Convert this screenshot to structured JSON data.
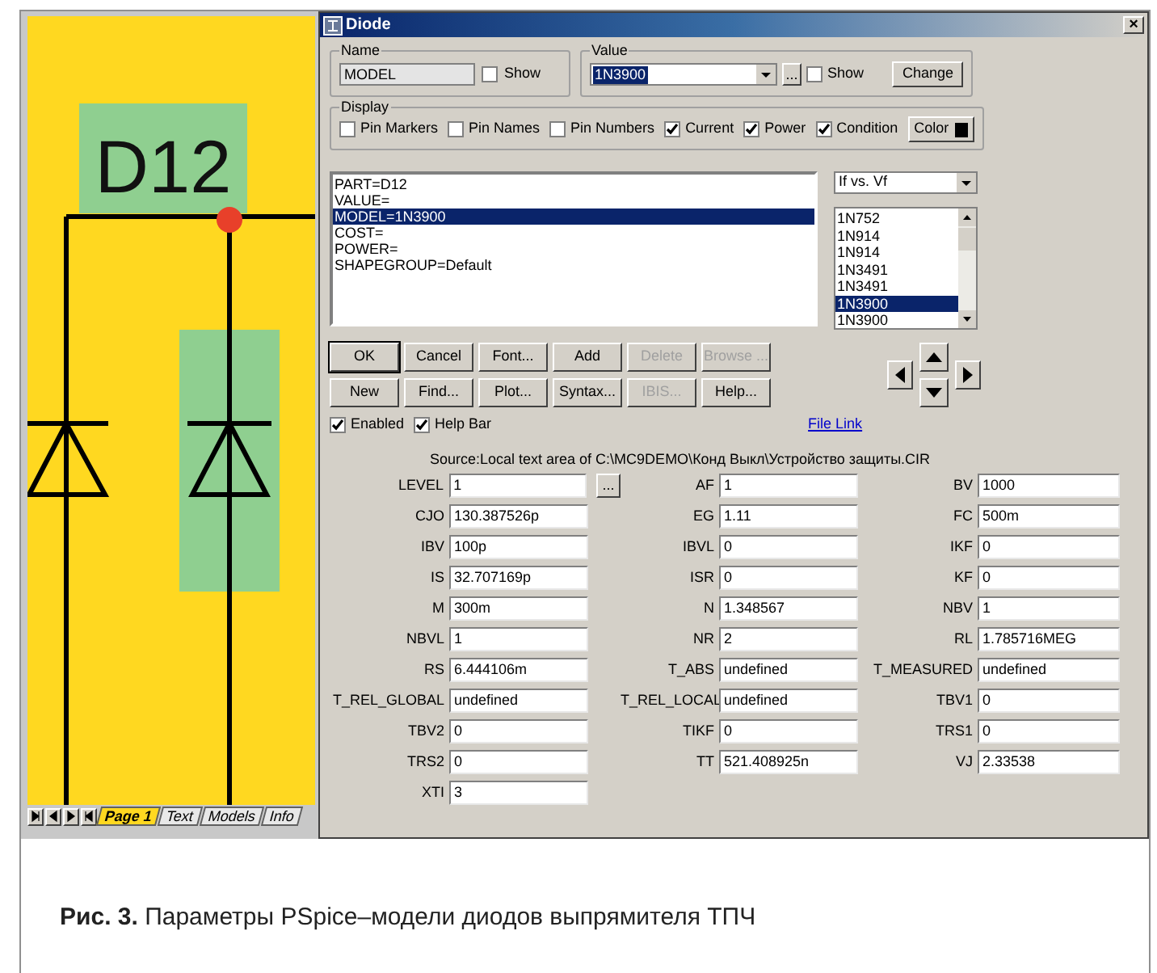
{
  "schematic": {
    "part_label": "D12",
    "tabs": [
      {
        "label": "Page 1",
        "selected": true
      },
      {
        "label": "Text",
        "selected": false
      },
      {
        "label": "Models",
        "selected": false
      },
      {
        "label": "Info",
        "selected": false
      }
    ]
  },
  "dialog": {
    "title": "Diode",
    "close": "×",
    "name_group": {
      "title": "Name",
      "value": "MODEL",
      "show": {
        "label": "Show",
        "checked": false
      }
    },
    "value_group": {
      "title": "Value",
      "value": "1N3900",
      "browse": "...",
      "show": {
        "label": "Show",
        "checked": false
      },
      "change": "Change"
    },
    "display": {
      "title": "Display",
      "color_button": "Color",
      "options": [
        {
          "label": "Pin Markers",
          "checked": false
        },
        {
          "label": "Pin Names",
          "checked": false
        },
        {
          "label": "Pin Numbers",
          "checked": false
        },
        {
          "label": "Current",
          "checked": true
        },
        {
          "label": "Power",
          "checked": true
        },
        {
          "label": "Condition",
          "checked": true
        }
      ]
    },
    "attributes": [
      {
        "text": "PART=D12",
        "selected": false
      },
      {
        "text": "VALUE=",
        "selected": false
      },
      {
        "text": "MODEL=1N3900",
        "selected": true
      },
      {
        "text": "COST=",
        "selected": false
      },
      {
        "text": "POWER=",
        "selected": false
      },
      {
        "text": "SHAPEGROUP=Default",
        "selected": false
      }
    ],
    "plot_select": "If vs. Vf",
    "models": [
      {
        "text": "1N752",
        "selected": false
      },
      {
        "text": "1N914",
        "selected": false
      },
      {
        "text": "1N914",
        "selected": false
      },
      {
        "text": "1N3491",
        "selected": false
      },
      {
        "text": "1N3491",
        "selected": false
      },
      {
        "text": "1N3900",
        "selected": true
      },
      {
        "text": "1N3900",
        "selected": false
      }
    ],
    "button_rows": [
      [
        {
          "label": "OK",
          "disabled": false,
          "default": true
        },
        {
          "label": "Cancel",
          "disabled": false,
          "default": false
        },
        {
          "label": "Font...",
          "disabled": false,
          "default": false
        },
        {
          "label": "Add",
          "disabled": false,
          "default": false
        },
        {
          "label": "Delete",
          "disabled": true,
          "default": false
        },
        {
          "label": "Browse ...",
          "disabled": true,
          "default": false
        }
      ],
      [
        {
          "label": "New",
          "disabled": false,
          "default": false
        },
        {
          "label": "Find...",
          "disabled": false,
          "default": false
        },
        {
          "label": "Plot...",
          "disabled": false,
          "default": false
        },
        {
          "label": "Syntax...",
          "disabled": false,
          "default": false
        },
        {
          "label": "IBIS...",
          "disabled": true,
          "default": false
        },
        {
          "label": "Help...",
          "disabled": false,
          "default": false
        }
      ]
    ],
    "checkboxes": [
      {
        "label": "Enabled",
        "checked": true
      },
      {
        "label": "Help Bar",
        "checked": true
      }
    ],
    "file_link": "File Link",
    "source": "Source:Local text area of C:\\MC9DEMO\\Конд Выкл\\Устройство защиты.CIR",
    "param_rows": [
      [
        {
          "name": "LEVEL",
          "value": "1",
          "browse": "..."
        },
        {
          "name": "AF",
          "value": "1"
        },
        {
          "name": "BV",
          "value": "1000"
        }
      ],
      [
        {
          "name": "CJO",
          "value": "130.387526p"
        },
        {
          "name": "EG",
          "value": "1.11"
        },
        {
          "name": "FC",
          "value": "500m"
        }
      ],
      [
        {
          "name": "IBV",
          "value": "100p"
        },
        {
          "name": "IBVL",
          "value": "0"
        },
        {
          "name": "IKF",
          "value": "0"
        }
      ],
      [
        {
          "name": "IS",
          "value": "32.707169p"
        },
        {
          "name": "ISR",
          "value": "0"
        },
        {
          "name": "KF",
          "value": "0"
        }
      ],
      [
        {
          "name": "M",
          "value": "300m"
        },
        {
          "name": "N",
          "value": "1.348567"
        },
        {
          "name": "NBV",
          "value": "1"
        }
      ],
      [
        {
          "name": "NBVL",
          "value": "1"
        },
        {
          "name": "NR",
          "value": "2"
        },
        {
          "name": "RL",
          "value": "1.785716MEG"
        }
      ],
      [
        {
          "name": "RS",
          "value": "6.444106m"
        },
        {
          "name": "T_ABS",
          "value": "undefined"
        },
        {
          "name": "T_MEASURED",
          "value": "undefined"
        }
      ],
      [
        {
          "name": "T_REL_GLOBAL",
          "value": "undefined"
        },
        {
          "name": "T_REL_LOCAL",
          "value": "undefined"
        },
        {
          "name": "TBV1",
          "value": "0"
        }
      ],
      [
        {
          "name": "TBV2",
          "value": "0"
        },
        {
          "name": "TIKF",
          "value": "0"
        },
        {
          "name": "TRS1",
          "value": "0"
        }
      ],
      [
        {
          "name": "TRS2",
          "value": "0"
        },
        {
          "name": "TT",
          "value": "521.408925n"
        },
        {
          "name": "VJ",
          "value": "2.33538"
        }
      ],
      [
        {
          "name": "XTI",
          "value": "3"
        }
      ]
    ]
  },
  "caption": "**Рис. 3.** Параметры PSpice–модели диодов выпрямителя ТПЧ"
}
